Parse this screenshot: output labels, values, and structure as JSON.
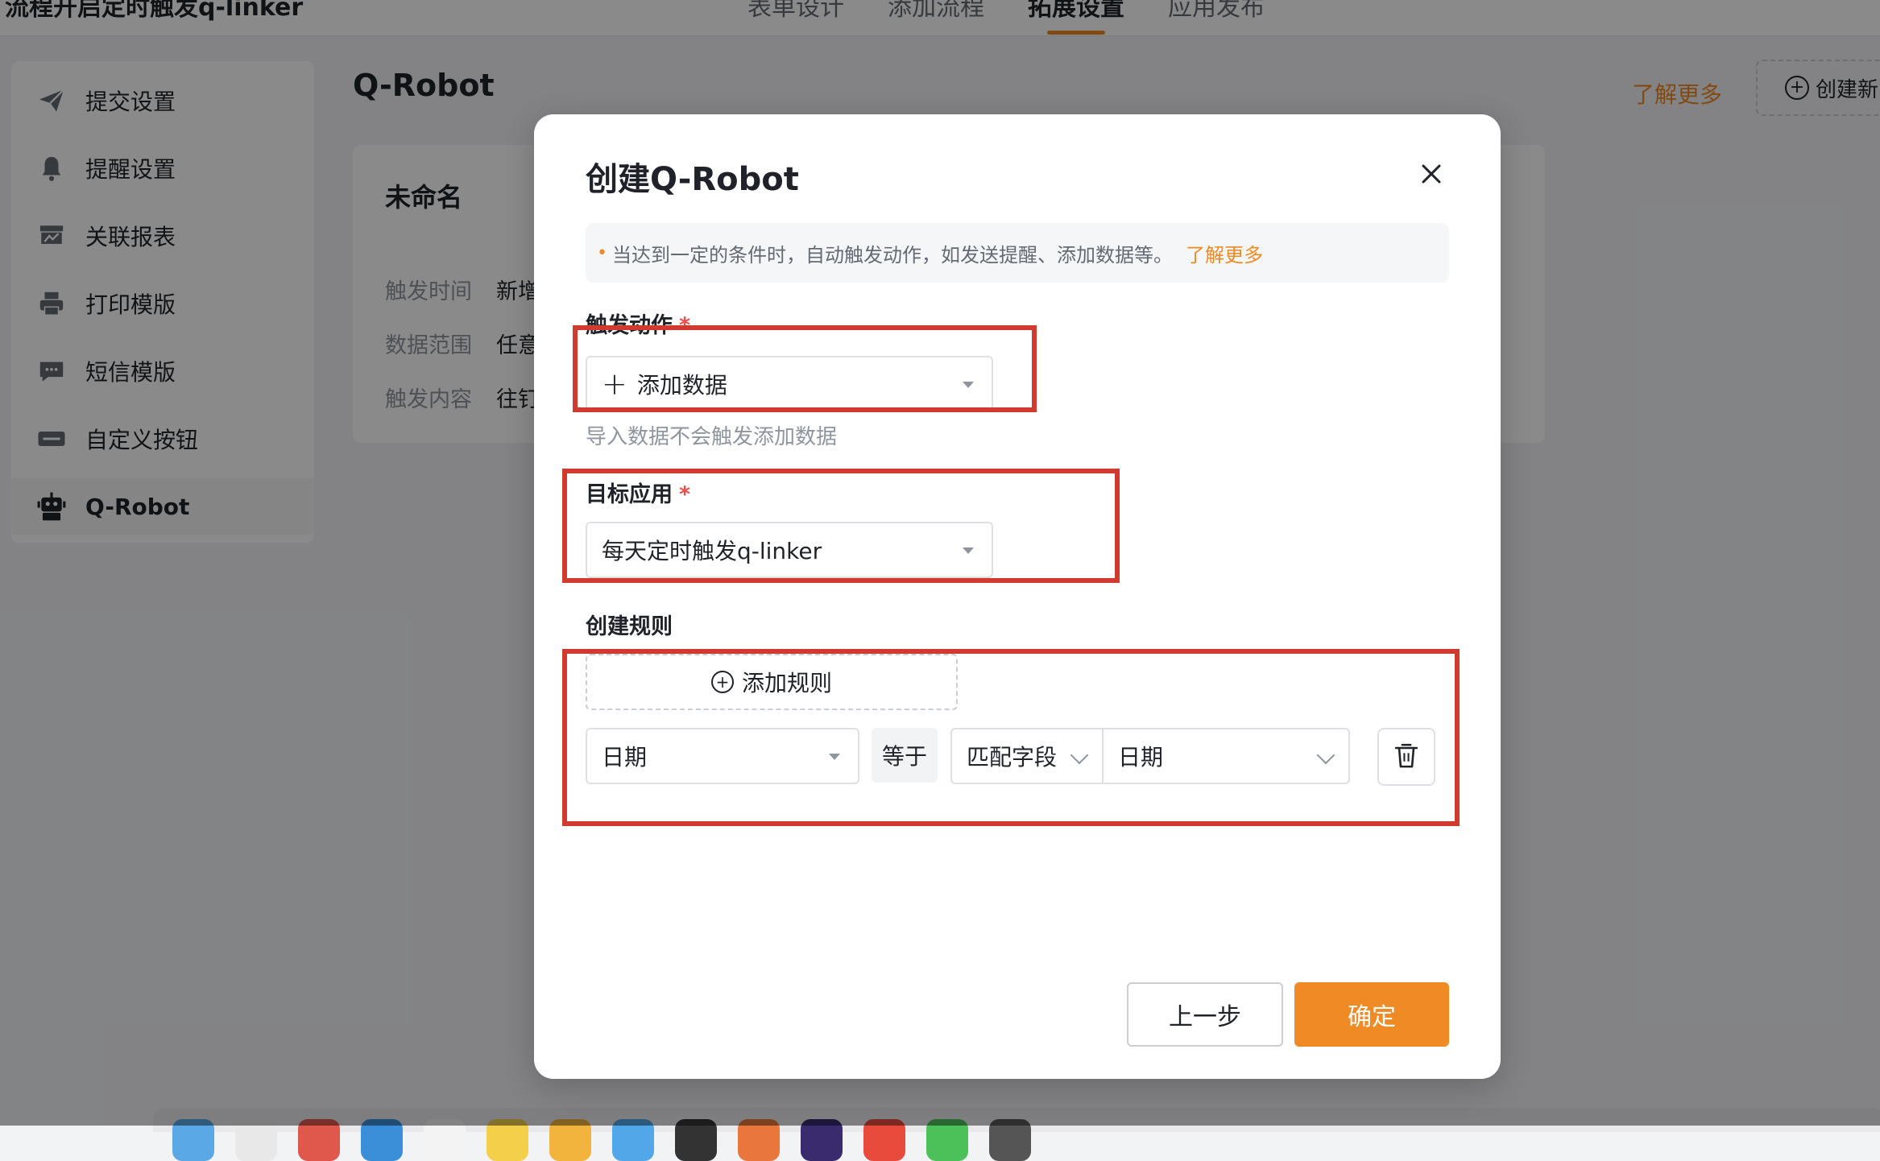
{
  "app": {
    "title": "流程开启定时触发q-linker",
    "tabs": [
      {
        "label": "表单设计"
      },
      {
        "label": "添加流程"
      },
      {
        "label": "拓展设置"
      },
      {
        "label": "应用发布"
      }
    ]
  },
  "sidebar": {
    "items": [
      {
        "label": "提交设置",
        "icon": "send-icon"
      },
      {
        "label": "提醒设置",
        "icon": "bell-icon"
      },
      {
        "label": "关联报表",
        "icon": "report-icon"
      },
      {
        "label": "打印模版",
        "icon": "printer-icon"
      },
      {
        "label": "短信模版",
        "icon": "sms-icon"
      },
      {
        "label": "自定义按钮",
        "icon": "custom-button-icon"
      },
      {
        "label": "Q-Robot",
        "icon": "robot-icon"
      }
    ]
  },
  "main": {
    "title": "Q-Robot",
    "learn_more": "了解更多",
    "create_new": "创建新",
    "card": {
      "name": "未命名",
      "rows": [
        {
          "key": "触发时间",
          "value": "新增"
        },
        {
          "key": "数据范围",
          "value": "任意"
        },
        {
          "key": "触发内容",
          "value": "往钉"
        }
      ]
    }
  },
  "modal": {
    "title": "创建Q-Robot",
    "notice": "当达到一定的条件时，自动触发动作，如发送提醒、添加数据等。",
    "notice_link": "了解更多",
    "trigger_action": {
      "label": "触发动作",
      "required_mark": "*",
      "value": "添加数据",
      "hint": "导入数据不会触发添加数据"
    },
    "target_app": {
      "label": "目标应用",
      "required_mark": "*",
      "value": "每天定时触发q-linker"
    },
    "rules": {
      "label": "创建规则",
      "add_rule": "添加规则",
      "rule": {
        "field": "日期",
        "operator": "等于",
        "match_type": "匹配字段",
        "match_value": "日期"
      }
    },
    "buttons": {
      "prev": "上一步",
      "confirm": "确定"
    }
  },
  "colors": {
    "accent": "#f08a24",
    "highlight": "#d13b2f",
    "required": "#f54a45"
  }
}
